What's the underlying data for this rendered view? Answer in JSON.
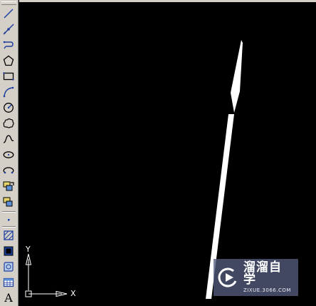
{
  "toolbar": {
    "tools": [
      {
        "name": "line-tool-icon"
      },
      {
        "name": "construction-line-tool-icon"
      },
      {
        "name": "polyline-tool-icon"
      },
      {
        "name": "polygon-tool-icon"
      },
      {
        "name": "rectangle-tool-icon"
      },
      {
        "name": "arc-tool-icon"
      },
      {
        "name": "circle-tool-icon"
      },
      {
        "name": "revision-cloud-tool-icon"
      },
      {
        "name": "spline-tool-icon"
      },
      {
        "name": "ellipse-tool-icon"
      },
      {
        "name": "ellipse-arc-tool-icon"
      },
      {
        "name": "insert-block-tool-icon"
      },
      {
        "name": "make-block-tool-icon"
      },
      {
        "name": "point-tool-icon"
      },
      {
        "name": "hatch-tool-icon"
      },
      {
        "name": "gradient-tool-icon"
      },
      {
        "name": "region-tool-icon"
      },
      {
        "name": "table-tool-icon"
      },
      {
        "name": "multiline-text-tool-icon",
        "text": "A"
      }
    ]
  },
  "ucs": {
    "x_label": "X",
    "y_label": "Y"
  },
  "watermark": {
    "name": "溜溜自学",
    "url": "ZIXUE.3066.COM"
  },
  "colors": {
    "toolbar_bg": "#d4d0c8",
    "canvas_bg": "#000000",
    "drawing_stroke": "#ffffff",
    "watermark_bg": "#545c7d",
    "icon_blue": "#1f3fa0"
  }
}
